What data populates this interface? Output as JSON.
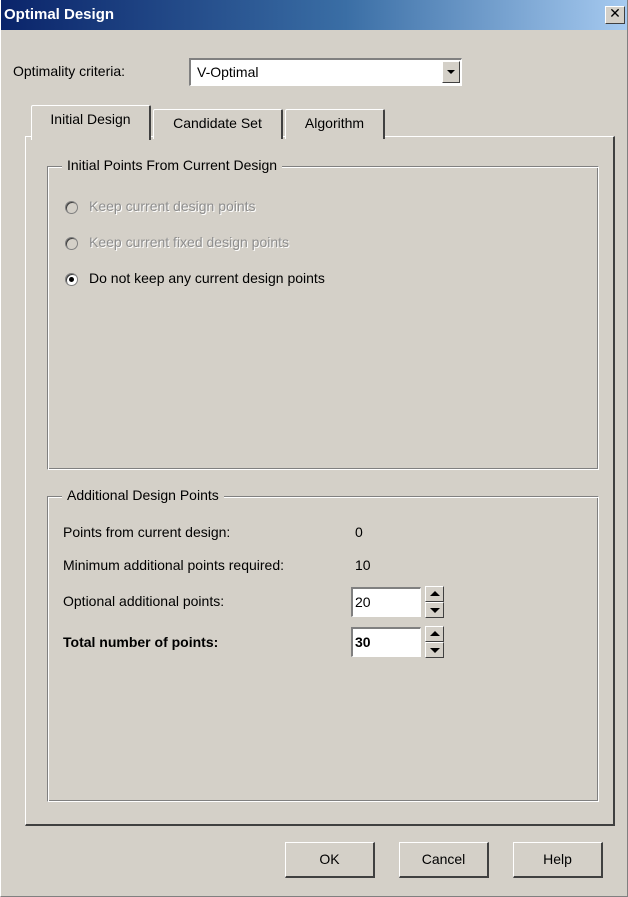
{
  "window": {
    "title": "Optimal Design",
    "close_glyph": "✕"
  },
  "criteria": {
    "label": "Optimality criteria:",
    "value": "V-Optimal"
  },
  "tabs": [
    {
      "label": "Initial Design",
      "active": true
    },
    {
      "label": "Candidate Set",
      "active": false
    },
    {
      "label": "Algorithm",
      "active": false
    }
  ],
  "initial_points": {
    "legend": "Initial Points From Current Design",
    "options": [
      {
        "label": "Keep current design points",
        "selected": false,
        "enabled": false
      },
      {
        "label": "Keep current fixed design points",
        "selected": false,
        "enabled": false
      },
      {
        "label": "Do not keep any current design points",
        "selected": true,
        "enabled": true
      }
    ]
  },
  "additional_points": {
    "legend": "Additional Design Points",
    "from_current_label": "Points from current design:",
    "from_current_value": "0",
    "min_required_label": "Minimum additional points required:",
    "min_required_value": "10",
    "optional_label": "Optional additional points:",
    "optional_value": "20",
    "total_label": "Total number of points:",
    "total_value": "30"
  },
  "buttons": {
    "ok": "OK",
    "cancel": "Cancel",
    "help": "Help"
  }
}
